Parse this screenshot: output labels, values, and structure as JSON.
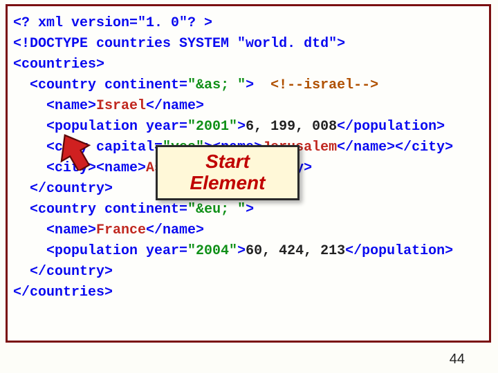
{
  "code": {
    "l1": "<? xml version=\"1. 0\"? >",
    "l2": "<!DOCTYPE countries SYSTEM \"world. dtd\">",
    "l3_open": "<countries>",
    "l4_open": "  <country ",
    "l4_attr": "continent=",
    "l4_val": "\"&as; \"",
    "l4_close": ">  ",
    "l4_comment": "<!--israel-->",
    "l5_a": "    <name>",
    "l5_b": "Israel",
    "l5_c": "</name>",
    "l6_a": "    <population ",
    "l6_attr": "year=",
    "l6_val": "\"2001\"",
    "l6_b": ">",
    "l6_num": "6, 199, 008",
    "l6_c": "</population>",
    "l7_a": "    <city ",
    "l7_attr": "capital=",
    "l7_val": "\"yes\"",
    "l7_b": "><name>",
    "l7_city": "Jerusalem",
    "l7_c": "</name></city>",
    "l8_a": "    <city><name>",
    "l8_city": "Ashdod",
    "l8_b": "</name></city>",
    "l9": "  </country>",
    "l10_open": "  <country ",
    "l10_attr": "continent=",
    "l10_val": "\"&eu; \"",
    "l10_close": ">",
    "l11_a": "    <name>",
    "l11_b": "France",
    "l11_c": "</name>",
    "l12_a": "    <population ",
    "l12_attr": "year=",
    "l12_val": "\"2004\"",
    "l12_b": ">",
    "l12_num": "60, 424, 213",
    "l12_c": "</population>",
    "l13": "  </country>",
    "l14": "</countries>"
  },
  "callout": {
    "line1": "Start",
    "line2": "Element"
  },
  "page_number": "44"
}
